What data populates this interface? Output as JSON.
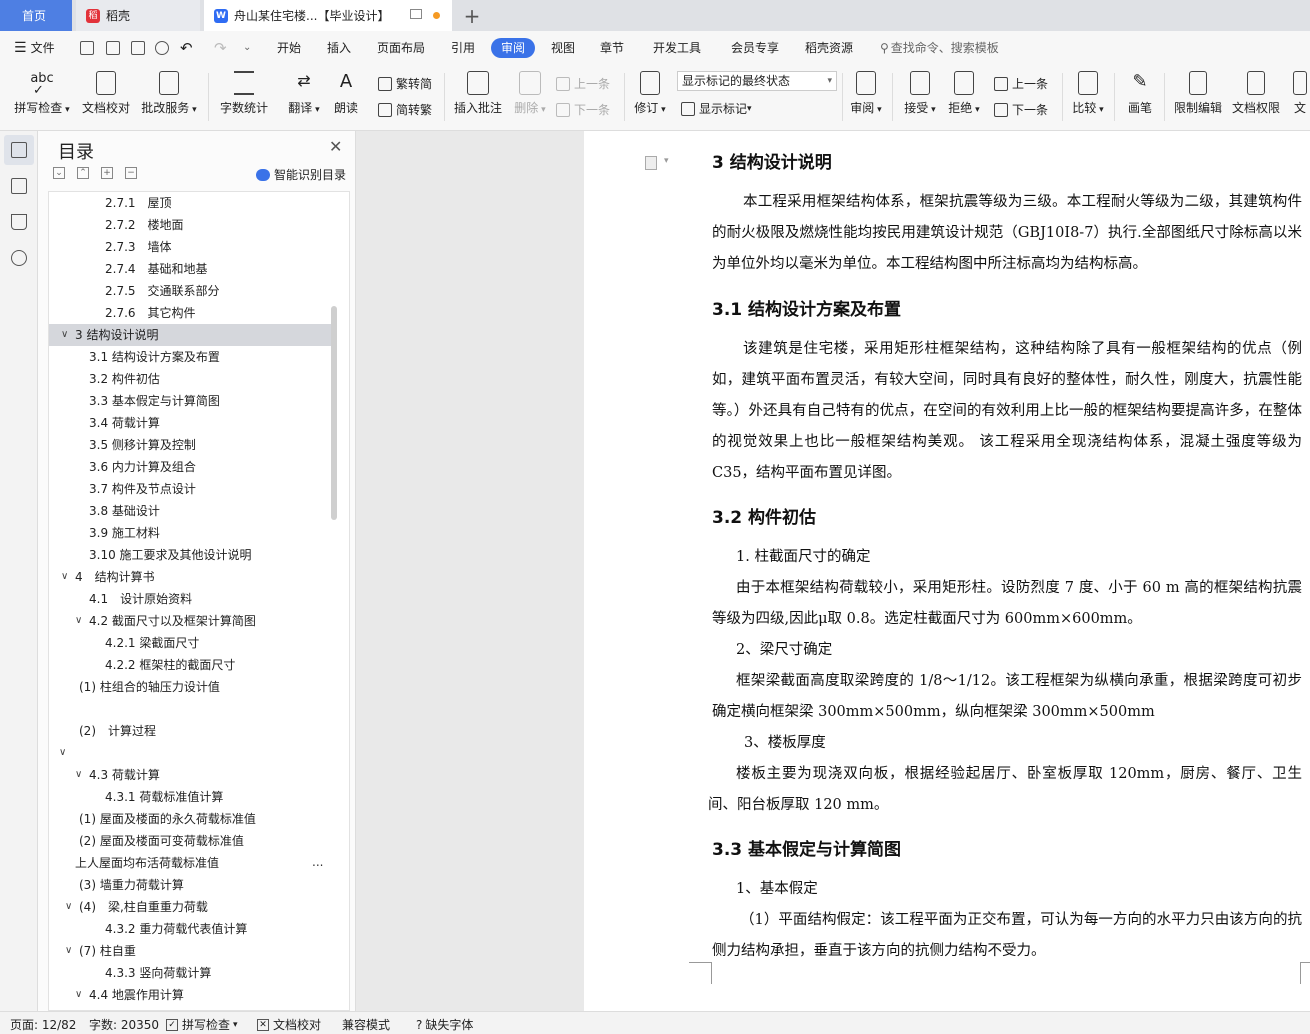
{
  "tabs": {
    "home": "首页",
    "daoke": "稻壳",
    "doc": "舟山某住宅楼...【毕业设计】",
    "add": "+"
  },
  "menu": {
    "file": "文件",
    "items": [
      "开始",
      "插入",
      "页面布局",
      "引用",
      "审阅",
      "视图",
      "章节",
      "开发工具",
      "会员专享",
      "稻壳资源"
    ],
    "active": "审阅",
    "search_placeholder": "查找命令、搜索模板"
  },
  "ribbon": {
    "spell": "拼写检查",
    "proof": "文档校对",
    "batch": "批改服务",
    "wordcount": "字数统计",
    "translate": "翻译",
    "read": "朗读",
    "trad": "繁转简",
    "simp": "简转繁",
    "insert_comment": "插入批注",
    "delete": "删除",
    "prev_comment": "上一条",
    "next_comment": "下一条",
    "revise": "修订",
    "markup_state": "显示标记的最终状态",
    "show_markup": "显示标记",
    "review": "审阅",
    "accept": "接受",
    "reject": "拒绝",
    "prev_change": "上一条",
    "next_change": "下一条",
    "compare": "比较",
    "pen": "画笔",
    "restrict": "限制编辑",
    "permission": "文档权限",
    "more": "文"
  },
  "toc": {
    "title": "目录",
    "smart": "智能识别目录",
    "items": [
      {
        "label": "2.7.1　屋顶",
        "indent": 3,
        "chev": ""
      },
      {
        "label": "2.7.2　楼地面",
        "indent": 3,
        "chev": ""
      },
      {
        "label": "2.7.3　墙体",
        "indent": 3,
        "chev": ""
      },
      {
        "label": "2.7.4　基础和地基",
        "indent": 3,
        "chev": ""
      },
      {
        "label": "2.7.5　交通联系部分",
        "indent": 3,
        "chev": ""
      },
      {
        "label": "2.7.6　其它构件",
        "indent": 3,
        "chev": ""
      },
      {
        "label": "3  结构设计说明",
        "indent": 1,
        "chev": "v",
        "sel": true
      },
      {
        "label": "3.1  结构设计方案及布置",
        "indent": 2,
        "chev": ""
      },
      {
        "label": "3.2  构件初估",
        "indent": 2,
        "chev": ""
      },
      {
        "label": "3.3  基本假定与计算简图",
        "indent": 2,
        "chev": ""
      },
      {
        "label": "3.4  荷载计算",
        "indent": 2,
        "chev": ""
      },
      {
        "label": "3.5  侧移计算及控制",
        "indent": 2,
        "chev": ""
      },
      {
        "label": "3.6  内力计算及组合",
        "indent": 2,
        "chev": ""
      },
      {
        "label": "3.7  构件及节点设计",
        "indent": 2,
        "chev": ""
      },
      {
        "label": "3.8  基础设计",
        "indent": 2,
        "chev": ""
      },
      {
        "label": "3.9  施工材料",
        "indent": 2,
        "chev": ""
      },
      {
        "label": "3.10  施工要求及其他设计说明",
        "indent": 2,
        "chev": ""
      },
      {
        "label": "4　结构计算书",
        "indent": 1,
        "chev": "v"
      },
      {
        "label": "4.1　设计原始资料",
        "indent": 2,
        "chev": ""
      },
      {
        "label": "4.2 截面尺寸以及框架计算简图",
        "indent": 2,
        "chev": "v"
      },
      {
        "label": "4.2.1  梁截面尺寸",
        "indent": 3,
        "chev": ""
      },
      {
        "label": "4.2.2  框架柱的截面尺寸",
        "indent": 3,
        "chev": ""
      },
      {
        "label": "(1)  柱组合的轴压力设计值",
        "indent": 1.5,
        "chev": ""
      },
      {
        "label": "",
        "indent": 1,
        "chev": ""
      },
      {
        "label": "(2)　计算过程",
        "indent": 1.5,
        "chev": ""
      },
      {
        "label": "",
        "indent": 0,
        "chev": "v"
      },
      {
        "label": "4.3  荷载计算",
        "indent": 2,
        "chev": "v"
      },
      {
        "label": "4.3.1  荷载标准值计算",
        "indent": 3,
        "chev": ""
      },
      {
        "label": "(1)  屋面及楼面的永久荷载标准值",
        "indent": 1.5,
        "chev": ""
      },
      {
        "label": "(2)  屋面及楼面可变荷载标准值",
        "indent": 1.5,
        "chev": ""
      },
      {
        "label": "上人屋面均布活荷载标准值",
        "indent": 1,
        "chev": ""
      },
      {
        "label": "(3)  墙重力荷载计算",
        "indent": 1.5,
        "chev": ""
      },
      {
        "label": "(4)　梁,柱自重重力荷载",
        "indent": 1.5,
        "chev": "v"
      },
      {
        "label": "4.3.2 重力荷载代表值计算",
        "indent": 3,
        "chev": ""
      },
      {
        "label": "(7)  柱自重",
        "indent": 1.5,
        "chev": "v"
      },
      {
        "label": "4.3.3  竖向荷载计算",
        "indent": 3,
        "chev": ""
      },
      {
        "label": "4.4  地震作用计算",
        "indent": 2,
        "chev": "v"
      }
    ],
    "more": "..."
  },
  "doc": {
    "h3": "3  结构设计说明",
    "p3": "本工程采用框架结构体系，框架抗震等级为三级。本工程耐火等级为二级，其建筑构件的耐火极限及燃烧性能均按民用建筑设计规范（GBJ10I8-7）执行.全部图纸尺寸除标高以米为单位外均以毫米为单位。本工程结构图中所注标高均为结构标高。",
    "h31": "3.1  结构设计方案及布置",
    "p31": "该建筑是住宅楼，采用矩形柱框架结构，这种结构除了具有一般框架结构的优点（例如，建筑平面布置灵活，有较大空间，同时具有良好的整体性，耐久性，刚度大，抗震性能等。）外还具有自己特有的优点，在空间的有效利用上比一般的框架结构要提高许多，在整体的视觉效果上也比一般框架结构美观。 该工程采用全现浇结构体系，混凝土强度等级为 C35，结构平面布置见详图。",
    "h32": "3.2  构件初估",
    "l1": "1. 柱截面尺寸的确定",
    "p321": "由于本框架结构荷载较小，采用矩形柱。设防烈度 7 度、小于 60 m 高的框架结构抗震等级为四级,因此μ取 0.8。选定柱截面尺寸为 600mm×600mm。",
    "l2": "2、梁尺寸确定",
    "p322": "框架梁截面高度取梁跨度的 1/8～1/12。该工程框架为纵横向承重，根据梁跨度可初步确定横向框架梁 300mm×500mm，纵向框架梁 300mm×500mm",
    "l3": "3、楼板厚度",
    "p323": "楼板主要为现浇双向板，根据经验起居厅、卧室板厚取 120mm，厨房、餐厅、卫生间、阳台板厚取 120 mm。",
    "h33": "3.3  基本假定与计算简图",
    "l4": "1、基本假定",
    "p331": "（1）平面结构假定：该工程平面为正交布置，可认为每一方向的水平力只由该方向的抗侧力结构承担，垂直于该方向的抗侧力结构不受力。"
  },
  "status": {
    "page": "页面: 12/82",
    "words": "字数: 20350",
    "spell": "拼写检查",
    "proof": "文档校对",
    "compat": "兼容模式",
    "missing_font": "缺失字体"
  }
}
